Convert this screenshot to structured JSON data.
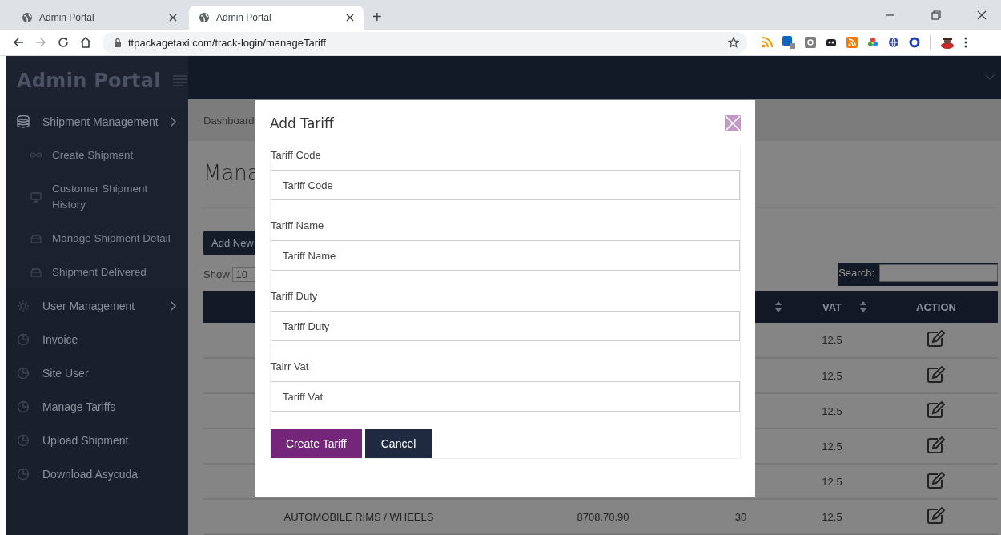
{
  "browser": {
    "tabs": [
      {
        "title": "Admin Portal",
        "selected": false
      },
      {
        "title": "Admin Portal",
        "selected": true
      }
    ],
    "new_tab": "+",
    "url": "ttpackagetaxi.com/track-login/manageTariff"
  },
  "sidebar": {
    "brand": "Admin Portal",
    "items": [
      {
        "label": "Shipment Management",
        "has_submenu": true,
        "children": [
          {
            "label": "Create Shipment"
          },
          {
            "label": "Customer Shipment History"
          },
          {
            "label": "Manage Shipment Detail"
          },
          {
            "label": "Shipment Delivered"
          }
        ]
      },
      {
        "label": "User Management",
        "has_submenu": true
      },
      {
        "label": "Invoice",
        "has_submenu": false
      },
      {
        "label": "Site User",
        "has_submenu": false
      },
      {
        "label": "Manage Tariffs",
        "has_submenu": false
      },
      {
        "label": "Upload Shipment",
        "has_submenu": false
      },
      {
        "label": "Download Asycuda",
        "has_submenu": false
      }
    ]
  },
  "breadcrumb": "Dashboard",
  "page_title": "Mana",
  "add_button": "Add New",
  "length_menu": {
    "label": "Show",
    "value": "10"
  },
  "search": {
    "label": "Search:"
  },
  "table": {
    "columns": [
      {
        "sortable": true
      },
      {
        "label": "VAT",
        "sortable": true
      },
      {
        "label": "ACTION",
        "sortable": false
      }
    ],
    "rows": [
      {
        "vat": "12.5"
      },
      {
        "vat": "12.5"
      },
      {
        "vat": "12.5"
      },
      {
        "vat": "12.5"
      },
      {
        "vat": "12.5"
      },
      {
        "column_1": "AUTOMOBILE RIMS / WHEELS",
        "column_2": "8708.70.90",
        "column_3": "30",
        "vat": "12.5"
      }
    ]
  },
  "modal": {
    "title": "Add Tariff",
    "fields": [
      {
        "label": "Tariff Code",
        "placeholder": "Tariff Code"
      },
      {
        "label": "Tariff Name",
        "placeholder": "Tariff Name"
      },
      {
        "label": "Tariff Duty",
        "placeholder": "Tariff Duty"
      },
      {
        "label": "Tairr Vat",
        "placeholder": "Tariff Vat"
      }
    ],
    "buttons": [
      {
        "label": "Create Tariff",
        "kind": "primary"
      },
      {
        "label": "Cancel",
        "kind": "secondary"
      }
    ]
  }
}
